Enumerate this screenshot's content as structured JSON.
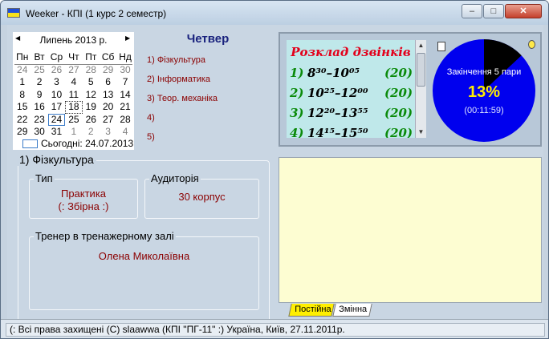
{
  "window": {
    "title": "Weeker - КПІ (1 курс 2 семестр)",
    "minimize": "–",
    "maximize": "□",
    "close": "✕"
  },
  "calendar": {
    "month_label": "Липень 2013 р.",
    "weekdays": [
      "Пн",
      "Вт",
      "Ср",
      "Чт",
      "Пт",
      "Сб",
      "Нд"
    ],
    "weeks": [
      [
        "24",
        "25",
        "26",
        "27",
        "28",
        "29",
        "30"
      ],
      [
        "1",
        "2",
        "3",
        "4",
        "5",
        "6",
        "7"
      ],
      [
        "8",
        "9",
        "10",
        "11",
        "12",
        "13",
        "14"
      ],
      [
        "15",
        "16",
        "17",
        "18",
        "19",
        "20",
        "21"
      ],
      [
        "22",
        "23",
        "24",
        "25",
        "26",
        "27",
        "28"
      ],
      [
        "29",
        "30",
        "31",
        "1",
        "2",
        "3",
        "4"
      ]
    ],
    "today_label": "Сьогодні: 24.07.2013"
  },
  "day": {
    "title": "Четвер",
    "lessons": [
      "1) Фізкультура",
      "2) Інформатика",
      "3) Теор. механіка",
      "4)",
      "5)"
    ]
  },
  "bells": {
    "title": "Розклад дзвінків",
    "rows": [
      {
        "num": "1)",
        "time": "8³⁰–10⁰⁵",
        "len": "(20)"
      },
      {
        "num": "2)",
        "time": "10²⁵–12⁰⁰",
        "len": "(20)"
      },
      {
        "num": "3)",
        "time": "12²⁰–13⁵⁵",
        "len": "(20)"
      },
      {
        "num": "4)",
        "time": "14¹⁵–15⁵⁰",
        "len": "(20)"
      }
    ]
  },
  "progress": {
    "label": "Закінчення 5 пари",
    "percent_text": "13%",
    "elapsed": "(00:11:59)",
    "fraction": 0.13,
    "colors": {
      "fill": "#000000",
      "rest": "#0000ee"
    }
  },
  "lesson_detail": {
    "title": "1) Фізкультура",
    "type_label": "Тип",
    "type_value_1": "Практика",
    "type_value_2": "(: Збірна :)",
    "room_label": "Аудиторія",
    "room_value": "30 корпус",
    "teacher_label": "Тренер в тренажерному залі",
    "teacher_value": "Олена Миколаївна"
  },
  "tabs": {
    "permanent": "Постійна",
    "variable": "Змінна"
  },
  "status": {
    "text": "(: Всі права захищені  (C)  slaawwa (КПІ \"ПГ-11\" :) Україна, Київ, 27.11.2011р."
  }
}
